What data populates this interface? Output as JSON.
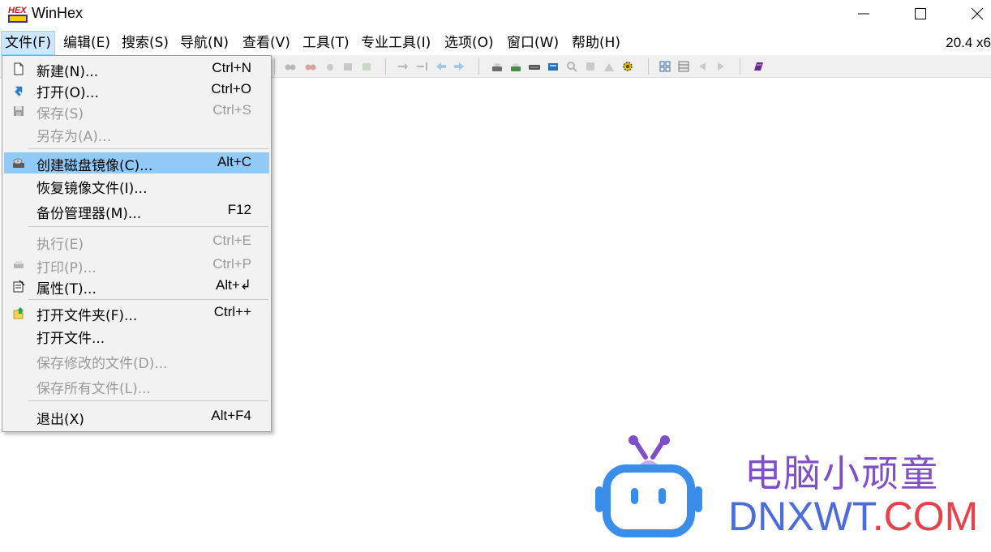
{
  "window": {
    "title": "WinHex",
    "logo_text": "HEX",
    "controls": [
      "minimize",
      "maximize",
      "close"
    ]
  },
  "menubar": {
    "items": [
      "文件(F)",
      "编辑(E)",
      "搜索(S)",
      "导航(N)",
      "查看(V)",
      "工具(T)",
      "专业工具(I)",
      "选项(O)",
      "窗口(W)",
      "帮助(H)"
    ],
    "active": "文件(F)",
    "version": "20.4 x6"
  },
  "file_menu": {
    "items": [
      {
        "label": "新建(N)...",
        "shortcut": "Ctrl+N",
        "icon": "new-file-icon",
        "enabled": true
      },
      {
        "label": "打开(O)...",
        "shortcut": "Ctrl+O",
        "icon": "open-arrow-icon",
        "enabled": true
      },
      {
        "label": "保存(S)",
        "shortcut": "Ctrl+S",
        "icon": "save-disk-icon",
        "enabled": false
      },
      {
        "label": "另存为(A)...",
        "shortcut": "",
        "icon": "",
        "enabled": false
      },
      {
        "label": "创建磁盘镜像(C)...",
        "shortcut": "Alt+C",
        "icon": "disk-image-icon",
        "enabled": true,
        "highlighted": true
      },
      {
        "label": "恢复镜像文件(I)...",
        "shortcut": "",
        "icon": "",
        "enabled": true
      },
      {
        "label": "备份管理器(M)...",
        "shortcut": "F12",
        "icon": "",
        "enabled": true
      },
      {
        "label": "执行(E)",
        "shortcut": "Ctrl+E",
        "icon": "",
        "enabled": false
      },
      {
        "label": "打印(P)...",
        "shortcut": "Ctrl+P",
        "icon": "printer-icon",
        "enabled": false
      },
      {
        "label": "属性(T)...",
        "shortcut": "Alt+↲",
        "icon": "properties-icon",
        "enabled": true
      },
      {
        "label": "打开文件夹(F)...",
        "shortcut": "Ctrl++",
        "icon": "open-folder-icon",
        "enabled": true
      },
      {
        "label": "打开文件...",
        "shortcut": "",
        "icon": "",
        "enabled": true
      },
      {
        "label": "保存修改的文件(D)...",
        "shortcut": "",
        "icon": "",
        "enabled": false
      },
      {
        "label": "保存所有文件(L)...",
        "shortcut": "",
        "icon": "",
        "enabled": false
      },
      {
        "label": "退出(X)",
        "shortcut": "Alt+F4",
        "icon": "",
        "enabled": true
      }
    ]
  },
  "watermark": {
    "cn_text": "电脑小顽童",
    "en_text_part1": "DNXWT",
    "en_text_part2": ".COM"
  },
  "colors": {
    "menu_highlight": "#91c9f7",
    "menubar_active": "#cce8ff",
    "disabled_text": "#9a9a9a",
    "watermark_purple": "#7f4fc8",
    "watermark_blue": "#4c6cd8",
    "watermark_red": "#e5434b"
  }
}
